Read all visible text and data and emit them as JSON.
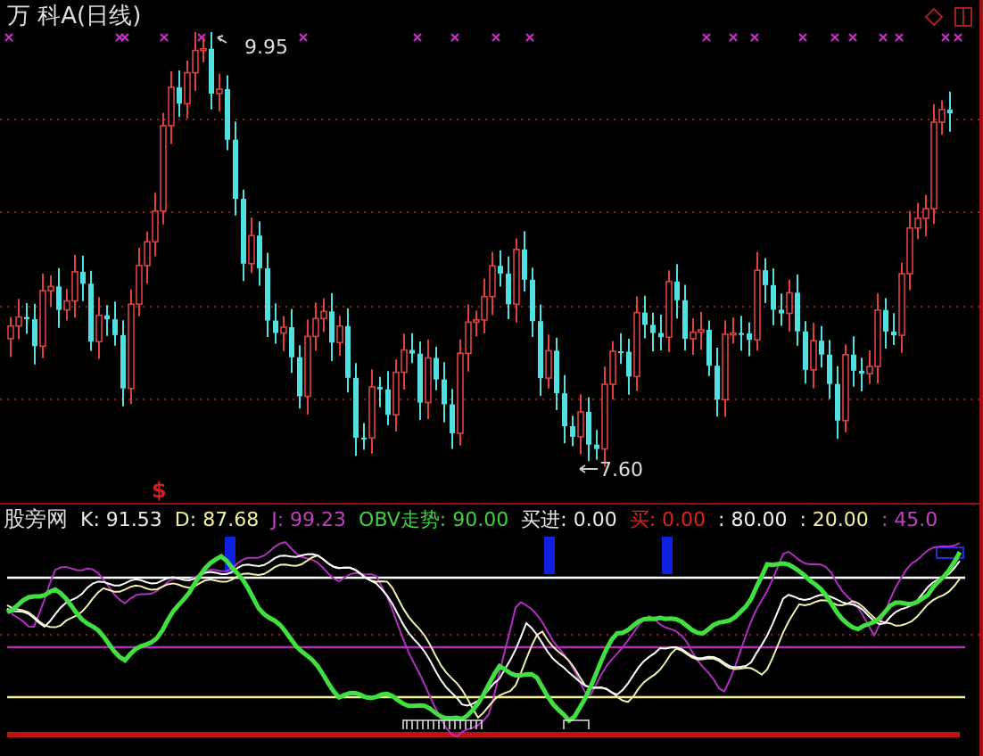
{
  "window": {
    "title": "万 科A(日线)"
  },
  "price_panel": {
    "high_label": "9.95",
    "low_label": "7.60",
    "signal_mark": "$"
  },
  "indicator_panel": {
    "name": "股旁网",
    "readings": [
      {
        "label": "K: 91.53",
        "color": "#e8e8e8"
      },
      {
        "label": "D: 87.68",
        "color": "#f0f0a0"
      },
      {
        "label": "J: 99.23",
        "color": "#c040c0"
      },
      {
        "label": "OBV走势: 90.00",
        "color": "#40d040"
      },
      {
        "label": "买进: 0.00",
        "color": "#e8e8e8"
      },
      {
        "label": "买: 0.00",
        "color": "#e02020"
      },
      {
        "label": ": 80.00",
        "color": "#f0f0f0"
      },
      {
        "label": ": 20.00",
        "color": "#f0f0a0"
      },
      {
        "label": ": 45.0",
        "color": "#c040c0"
      }
    ]
  }
}
